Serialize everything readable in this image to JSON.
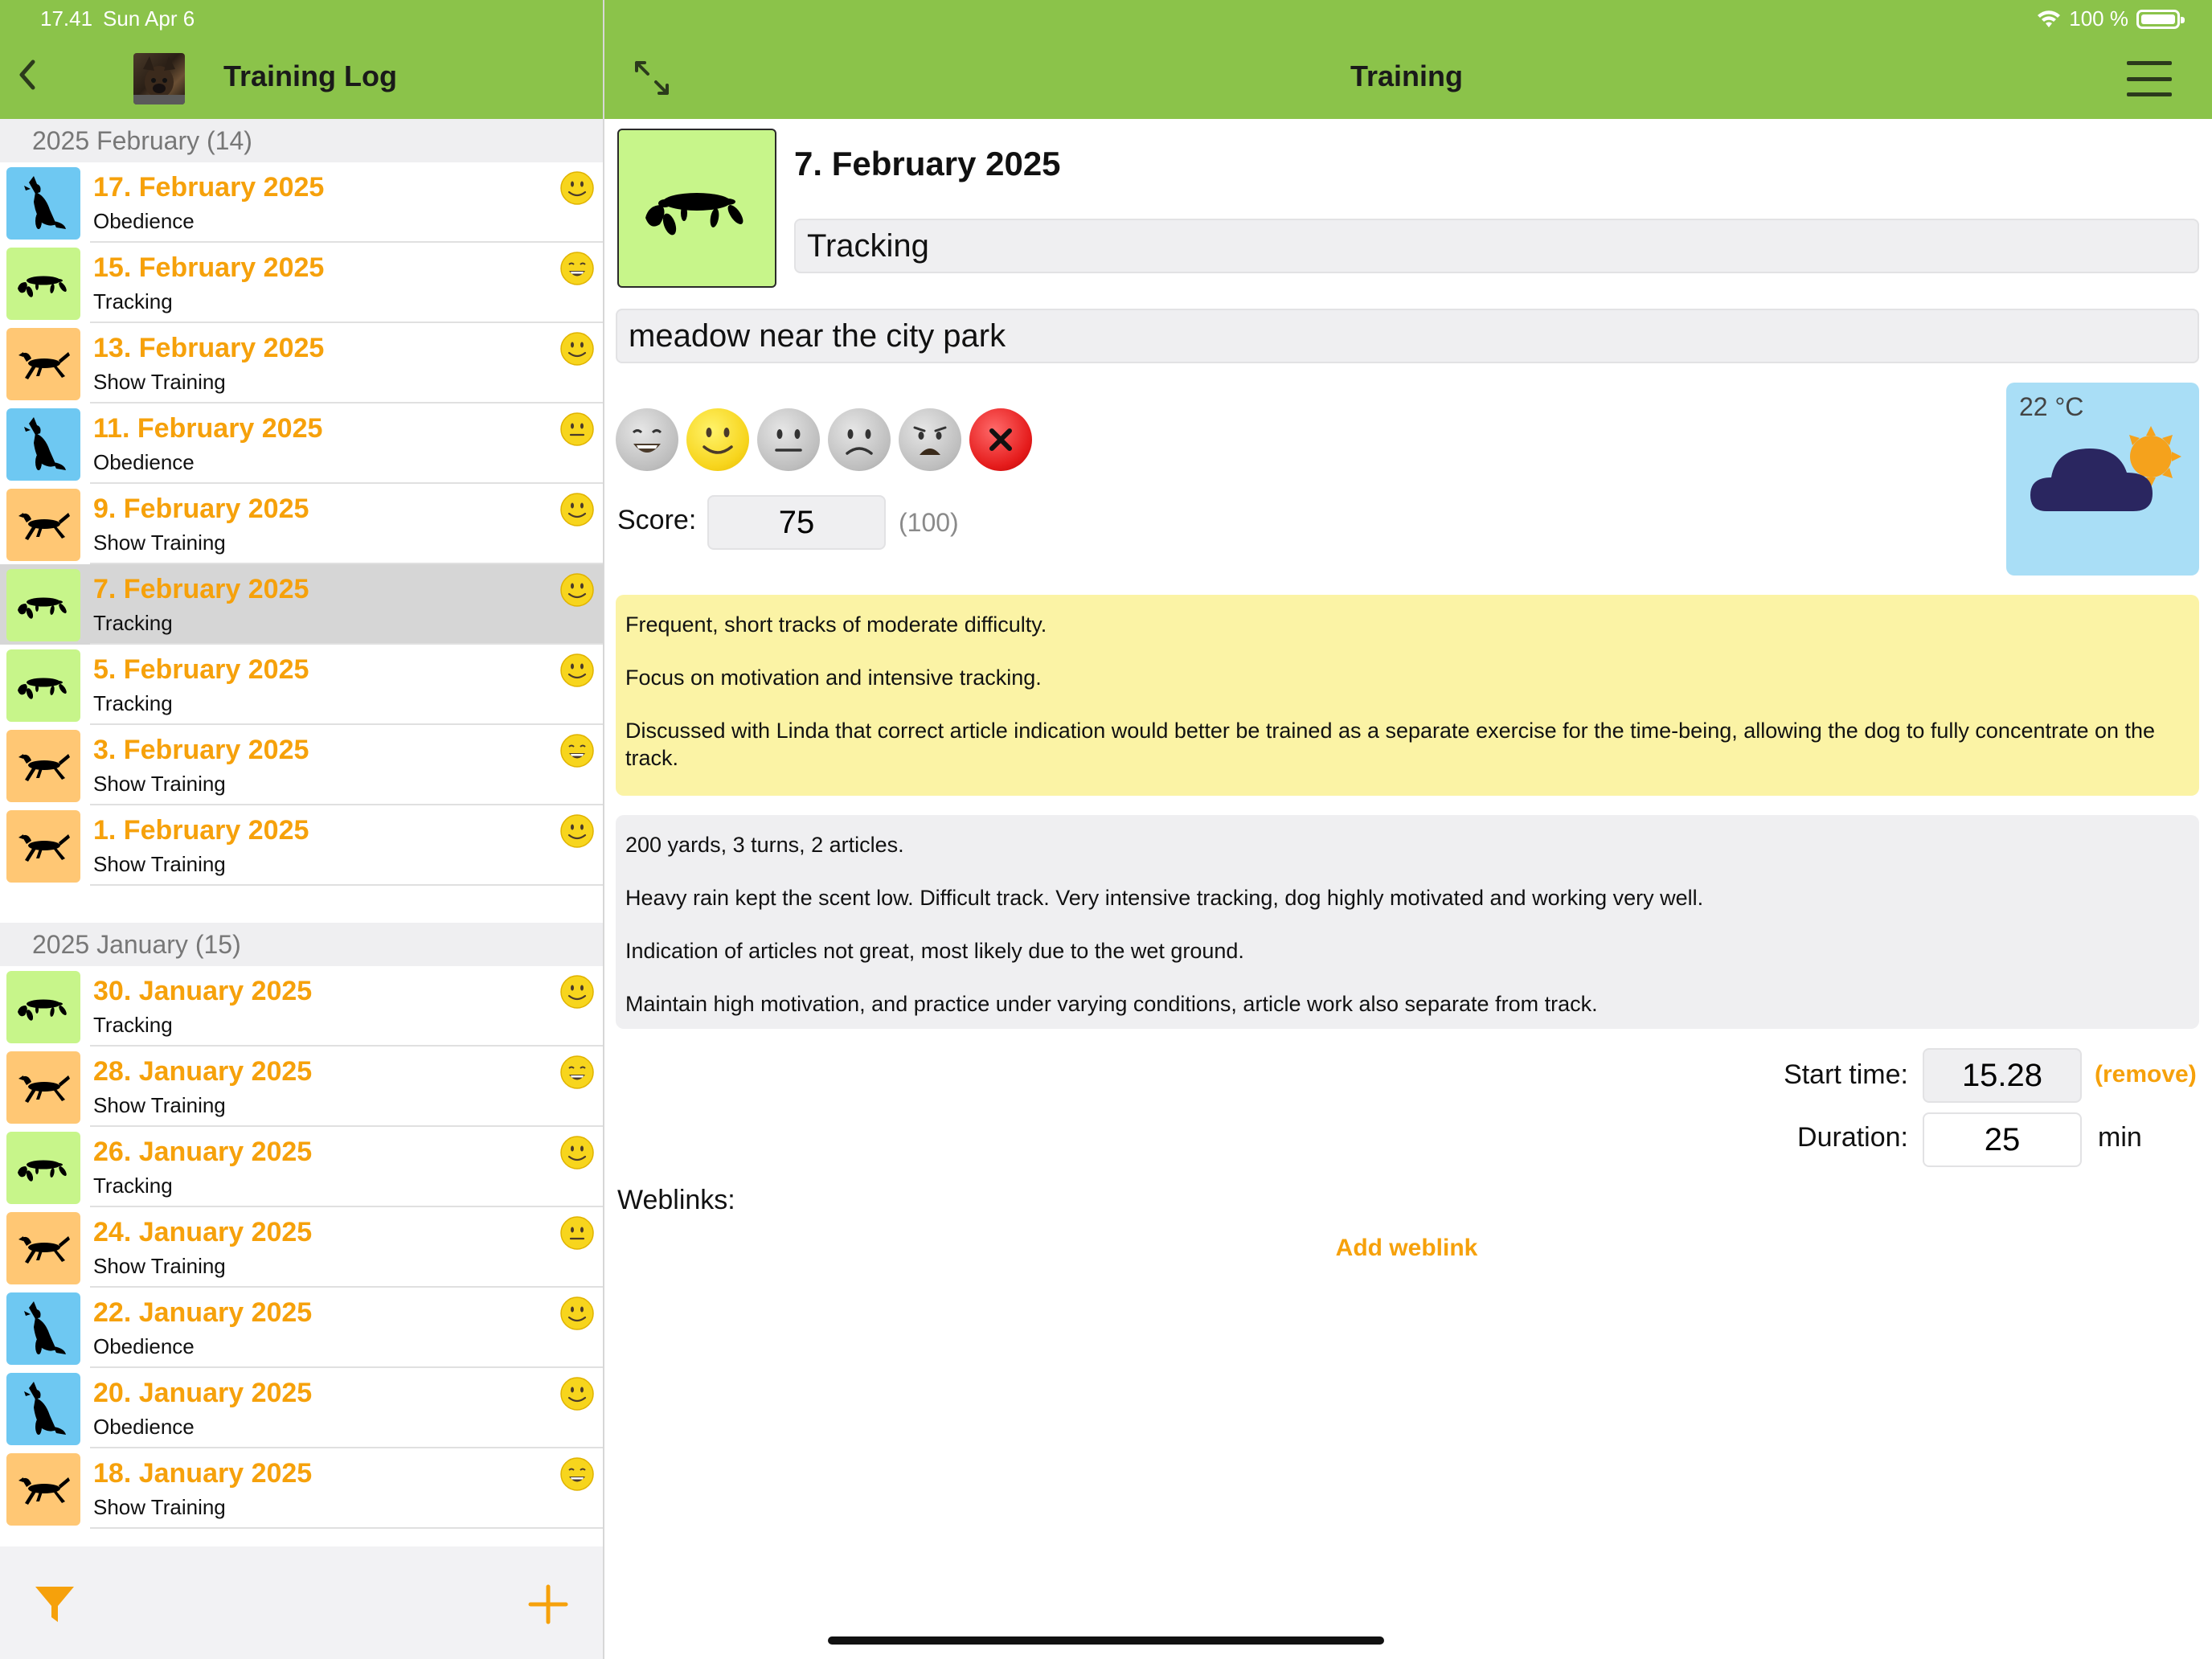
{
  "status_bar": {
    "time": "17.41",
    "date": "Sun Apr 6",
    "battery": "100 %"
  },
  "left_header": {
    "title": "Training Log"
  },
  "right_header": {
    "title": "Training"
  },
  "colors": {
    "accent": "#f6a10b",
    "header_green": "#8bc34a",
    "obedience": "#6ec8f2",
    "tracking": "#c7f58a",
    "show_training": "#ffc774"
  },
  "sections": [
    {
      "title": "2025 February (14)",
      "rows": [
        {
          "date": "17. February 2025",
          "type": "Obedience",
          "kind": "obedience",
          "mood": "smile"
        },
        {
          "date": "15. February 2025",
          "type": "Tracking",
          "kind": "tracking",
          "mood": "grin"
        },
        {
          "date": "13. February 2025",
          "type": "Show Training",
          "kind": "show",
          "mood": "smile"
        },
        {
          "date": "11. February 2025",
          "type": "Obedience",
          "kind": "obedience",
          "mood": "neutral"
        },
        {
          "date": "9. February 2025",
          "type": "Show Training",
          "kind": "show",
          "mood": "smile"
        },
        {
          "date": "7. February 2025",
          "type": "Tracking",
          "kind": "tracking",
          "mood": "smile",
          "selected": true
        },
        {
          "date": "5. February 2025",
          "type": "Tracking",
          "kind": "tracking",
          "mood": "smile"
        },
        {
          "date": "3. February 2025",
          "type": "Show Training",
          "kind": "show",
          "mood": "grin"
        },
        {
          "date": "1. February 2025",
          "type": "Show Training",
          "kind": "show",
          "mood": "smile"
        }
      ]
    },
    {
      "title": "2025 January (15)",
      "rows": [
        {
          "date": "30. January 2025",
          "type": "Tracking",
          "kind": "tracking",
          "mood": "smile"
        },
        {
          "date": "28. January 2025",
          "type": "Show Training",
          "kind": "show",
          "mood": "grin"
        },
        {
          "date": "26. January 2025",
          "type": "Tracking",
          "kind": "tracking",
          "mood": "smile"
        },
        {
          "date": "24. January 2025",
          "type": "Show Training",
          "kind": "show",
          "mood": "neutral"
        },
        {
          "date": "22. January 2025",
          "type": "Obedience",
          "kind": "obedience",
          "mood": "smile"
        },
        {
          "date": "20. January 2025",
          "type": "Obedience",
          "kind": "obedience",
          "mood": "smile"
        },
        {
          "date": "18. January 2025",
          "type": "Show Training",
          "kind": "show",
          "mood": "grin"
        }
      ]
    }
  ],
  "detail": {
    "date": "7. February 2025",
    "type": "Tracking",
    "location": "meadow near the city park",
    "mood_options": [
      "grin",
      "smile",
      "neutral",
      "frown",
      "distressed",
      "none"
    ],
    "score_label": "Score:",
    "score": "75",
    "score_max": "(100)",
    "weather": {
      "temperature": "22 °C",
      "icon": "cloud-sun-icon"
    },
    "goals": [
      "Frequent, short tracks of moderate difficulty.",
      "Focus on motivation and intensive tracking.",
      "Discussed with Linda that correct article indication would better be trained as a separate exercise for the time-being, allowing the dog to fully concentrate on the track."
    ],
    "notes": [
      "200 yards, 3 turns, 2 articles.",
      "Heavy rain kept the scent low. Difficult track. Very intensive tracking, dog highly motivated and working very well.",
      "Indication of articles not great, most likely due to the wet ground.",
      "Maintain high motivation, and practice under varying conditions, article work also separate from track."
    ],
    "start_time_label": "Start time:",
    "start_time": "15.28",
    "remove_label": "(remove)",
    "duration_label": "Duration:",
    "duration": "25",
    "duration_unit": "min",
    "weblinks_label": "Weblinks:",
    "add_weblink_label": "Add weblink"
  }
}
